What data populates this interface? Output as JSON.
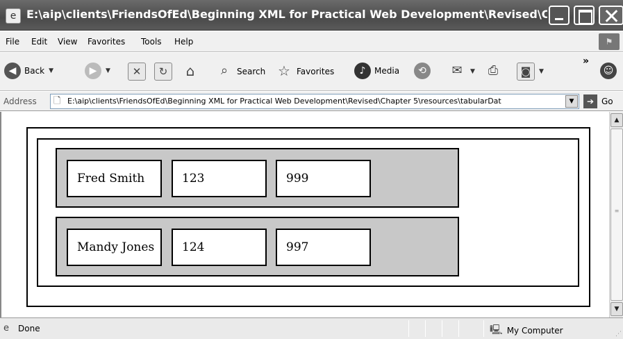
{
  "window": {
    "title": "E:\\aip\\clients\\FriendsOfEd\\Beginning XML for Practical Web Development\\Revised\\Chapter ...",
    "icon": "ie-page-icon"
  },
  "menubar": {
    "items": [
      "File",
      "Edit",
      "View",
      "Favorites",
      "Tools",
      "Help"
    ]
  },
  "toolbar": {
    "back_label": "Back",
    "search_label": "Search",
    "favorites_label": "Favorites",
    "media_label": "Media",
    "overflow_label": "»"
  },
  "address": {
    "label": "Address",
    "value": "E:\\aip\\clients\\FriendsOfEd\\Beginning XML for Practical Web Development\\Revised\\Chapter 5\\resources\\tabularDat",
    "go_label": "Go"
  },
  "table": {
    "rows": [
      {
        "cells": [
          "Fred Smith",
          "123",
          "999"
        ]
      },
      {
        "cells": [
          "Mandy Jones",
          "124",
          "997"
        ]
      }
    ]
  },
  "statusbar": {
    "status_text": "Done",
    "zone_label": "My Computer"
  }
}
